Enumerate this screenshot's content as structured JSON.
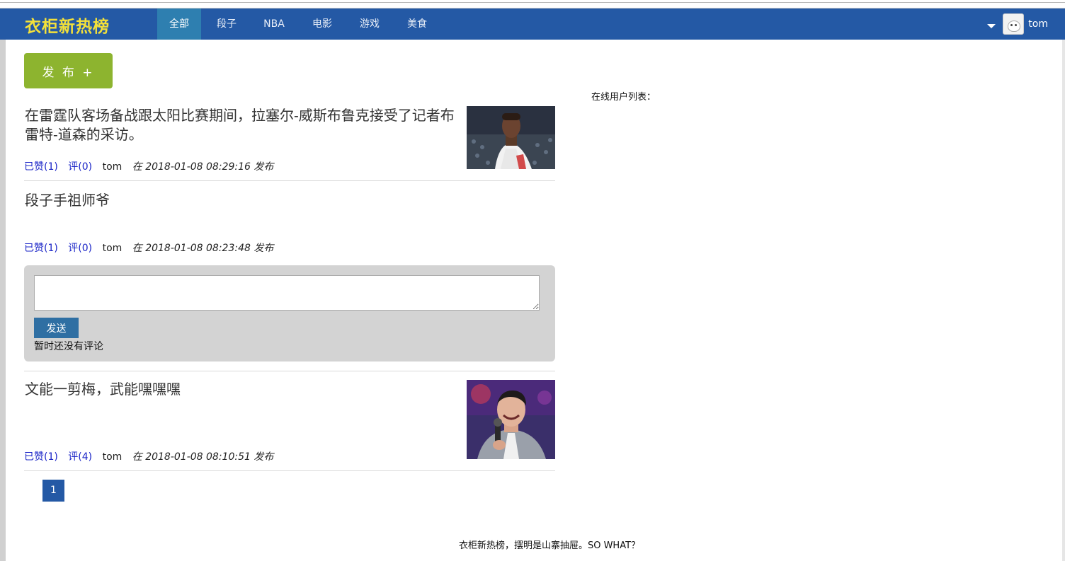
{
  "brand": "衣柜新热榜",
  "nav": [
    {
      "label": "全部",
      "active": true
    },
    {
      "label": "段子",
      "active": false
    },
    {
      "label": "NBA",
      "active": false
    },
    {
      "label": "电影",
      "active": false
    },
    {
      "label": "游戏",
      "active": false
    },
    {
      "label": "美食",
      "active": false
    }
  ],
  "user": {
    "name": "tom",
    "menu_icon": "caret-down-icon",
    "avatar_icon": "avatar-icon"
  },
  "publish_label": "发 布 +",
  "posts": [
    {
      "text": "在雷霆队客场备战跟太阳比赛期间，拉塞尔-威斯布鲁克接受了记者布雷特-道森的采访。",
      "like": "已赞(1)",
      "comment": "评(0)",
      "author": "tom",
      "time": "在 2018-01-08 08:29:16 发布",
      "has_image": true
    },
    {
      "text": "段子手祖师爷",
      "like": "已赞(1)",
      "comment": "评(0)",
      "author": "tom",
      "time": "在 2018-01-08 08:23:48 发布",
      "has_image": false
    },
    {
      "text": "文能一剪梅，武能嘿嘿嘿",
      "like": "已赞(1)",
      "comment": "评(4)",
      "author": "tom",
      "time": "在 2018-01-08 08:10:51 发布",
      "has_image": true
    }
  ],
  "comment_panel": {
    "input_value": "",
    "send_label": "发送",
    "empty_text": "暂时还没有评论"
  },
  "pagination": {
    "current": "1"
  },
  "online_users_label": "在线用户列表：",
  "footer": "衣柜新热榜，摆明是山寨抽屉。SO WHAT？"
}
